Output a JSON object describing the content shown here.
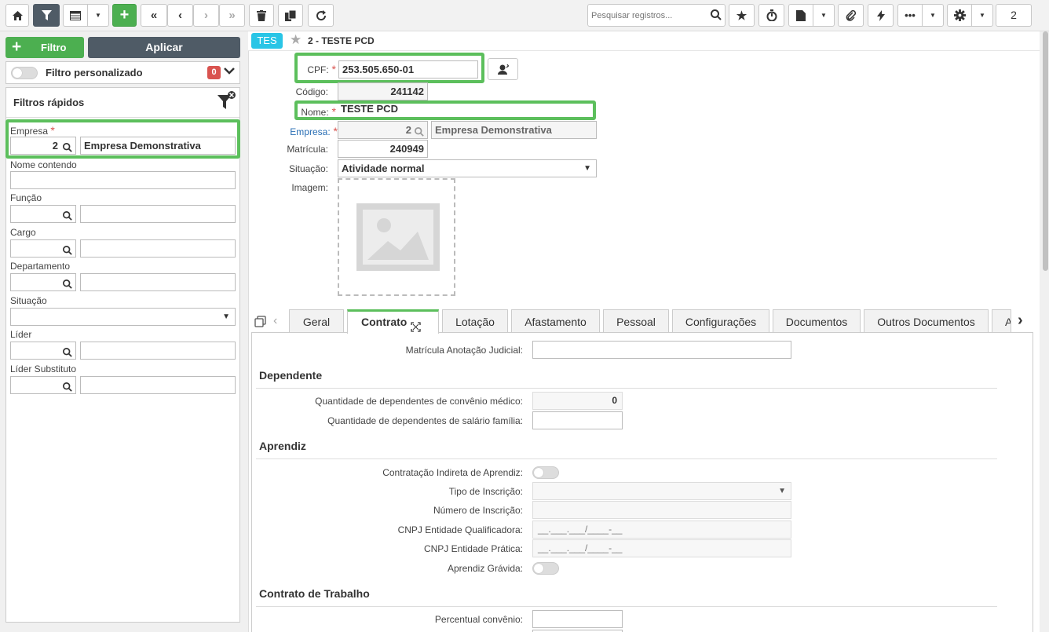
{
  "toolbar": {
    "search_placeholder": "Pesquisar registros...",
    "page_number": "2"
  },
  "filter_panel": {
    "filter_button_label": "Filtro",
    "apply_button_label": "Aplicar",
    "custom_filter_label": "Filtro personalizado",
    "custom_filter_count": "0",
    "quick_filters_title": "Filtros rápidos",
    "empresa_label": "Empresa",
    "empresa_code": "2",
    "empresa_name": "Empresa Demonstrativa",
    "fields": [
      "Nome contendo",
      "Função",
      "Cargo",
      "Departamento",
      "Situação",
      "Líder",
      "Líder Substituto"
    ]
  },
  "record": {
    "tag": "TES",
    "title": "2 - TESTE PCD",
    "cpf_label": "CPF:",
    "cpf_value": "253.505.650-01",
    "codigo_label": "Código:",
    "codigo_value": "241142",
    "nome_label": "Nome:",
    "nome_value": "TESTE PCD",
    "empresa_label": "Empresa:",
    "empresa_code": "2",
    "empresa_name": "Empresa Demonstrativa",
    "matricula_label": "Matrícula:",
    "matricula_value": "240949",
    "situacao_label": "Situação:",
    "situacao_value": "Atividade normal",
    "imagem_label": "Imagem:"
  },
  "tabs": [
    "Geral",
    "Contrato",
    "Lotação",
    "Afastamento",
    "Pessoal",
    "Configurações",
    "Documentos",
    "Outros Documentos",
    "A"
  ],
  "active_tab": "Contrato",
  "contrato": {
    "matricula_judicial_label": "Matrícula Anotação Judicial:",
    "dependente_title": "Dependente",
    "dep_medico_label": "Quantidade de dependentes de convênio médico:",
    "dep_medico_value": "0",
    "dep_salario_label": "Quantidade de dependentes de salário família:",
    "aprendiz_title": "Aprendiz",
    "contratacao_indireta_label": "Contratação Indireta de Aprendiz:",
    "tipo_inscricao_label": "Tipo de Inscrição:",
    "numero_inscricao_label": "Número de Inscrição:",
    "cnpj_qualificadora_label": "CNPJ Entidade Qualificadora:",
    "cnpj_qualificadora_mask": "__.___.___/____-__",
    "cnpj_pratica_label": "CNPJ Entidade Prática:",
    "cnpj_pratica_mask": "__.___.___/____-__",
    "aprendiz_gravida_label": "Aprendiz Grávida:",
    "contrato_trabalho_title": "Contrato de Trabalho",
    "percentual_convenio_label": "Percentual convênio:"
  }
}
